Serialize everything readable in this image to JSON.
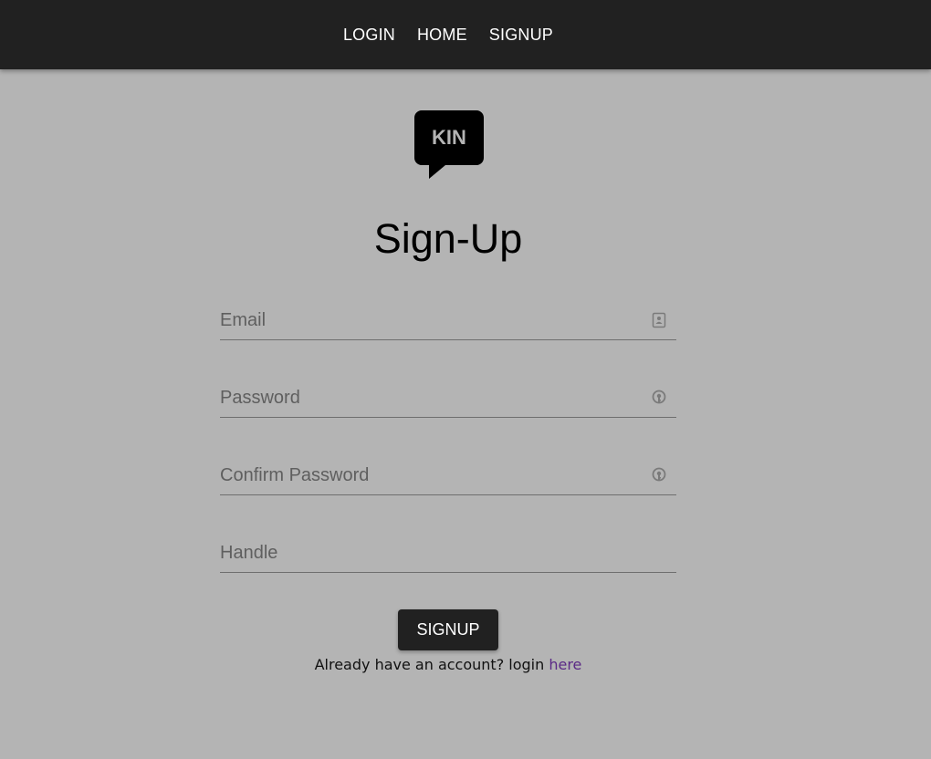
{
  "nav": {
    "items": [
      {
        "label": "LOGIN"
      },
      {
        "label": "HOME"
      },
      {
        "label": "SIGNUP"
      }
    ]
  },
  "logo": {
    "text": "KIN",
    "icon": "speech-bubble-logo"
  },
  "form": {
    "title": "Sign-Up",
    "fields": {
      "email": {
        "placeholder": "Email",
        "value": "",
        "icon": "contact-card-icon"
      },
      "password": {
        "placeholder": "Password",
        "value": "",
        "icon": "key-icon"
      },
      "confirm_password": {
        "placeholder": "Confirm Password",
        "value": "",
        "icon": "key-icon"
      },
      "handle": {
        "placeholder": "Handle",
        "value": ""
      }
    },
    "submit_label": "SIGNUP",
    "footer": {
      "prefix": "Already have an account? login ",
      "link_text": "here"
    }
  },
  "colors": {
    "navbar": "#212121",
    "background": "#b4b4b4",
    "button": "#212121",
    "link": "#5b2a86"
  }
}
